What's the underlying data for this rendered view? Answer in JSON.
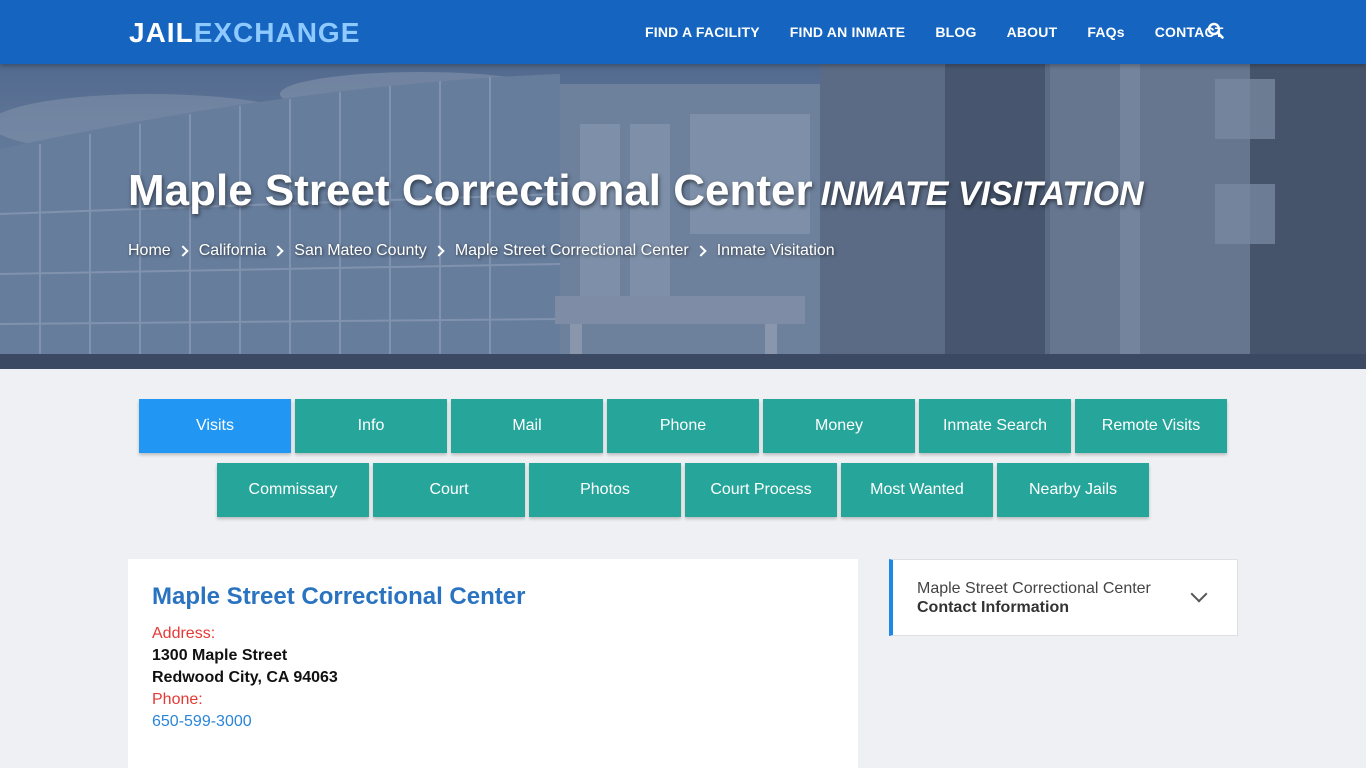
{
  "brand": {
    "part1": "JAIL",
    "part2": "EXCHANGE"
  },
  "nav": {
    "links": [
      "FIND A FACILITY",
      "FIND AN INMATE",
      "BLOG",
      "ABOUT",
      "FAQs",
      "CONTACT"
    ],
    "search_icon": "search-icon"
  },
  "hero": {
    "title": "Maple Street Correctional Center",
    "subtitle": "INMATE VISITATION",
    "breadcrumb": [
      "Home",
      "California",
      "San Mateo County",
      "Maple Street Correctional Center",
      "Inmate Visitation"
    ]
  },
  "tabs": {
    "row1": [
      "Visits",
      "Info",
      "Mail",
      "Phone",
      "Money",
      "Inmate Search",
      "Remote Visits"
    ],
    "row2": [
      "Commissary",
      "Court",
      "Photos",
      "Court Process",
      "Most Wanted",
      "Nearby Jails"
    ],
    "active": "Visits"
  },
  "facility": {
    "name": "Maple Street Correctional Center",
    "address_label": "Address:",
    "address_line1": "1300 Maple Street",
    "address_line2": "Redwood City, CA 94063",
    "phone_label": "Phone:",
    "phone": "650-599-3000"
  },
  "sidebar": {
    "line1": "Maple Street Correctional Center",
    "line2": "Contact Information"
  },
  "colors": {
    "nav_bg": "#1565c0",
    "tab": "#26a69a",
    "tab_active": "#2196f3",
    "label_red": "#e53935",
    "link_blue": "#2a73c0"
  }
}
